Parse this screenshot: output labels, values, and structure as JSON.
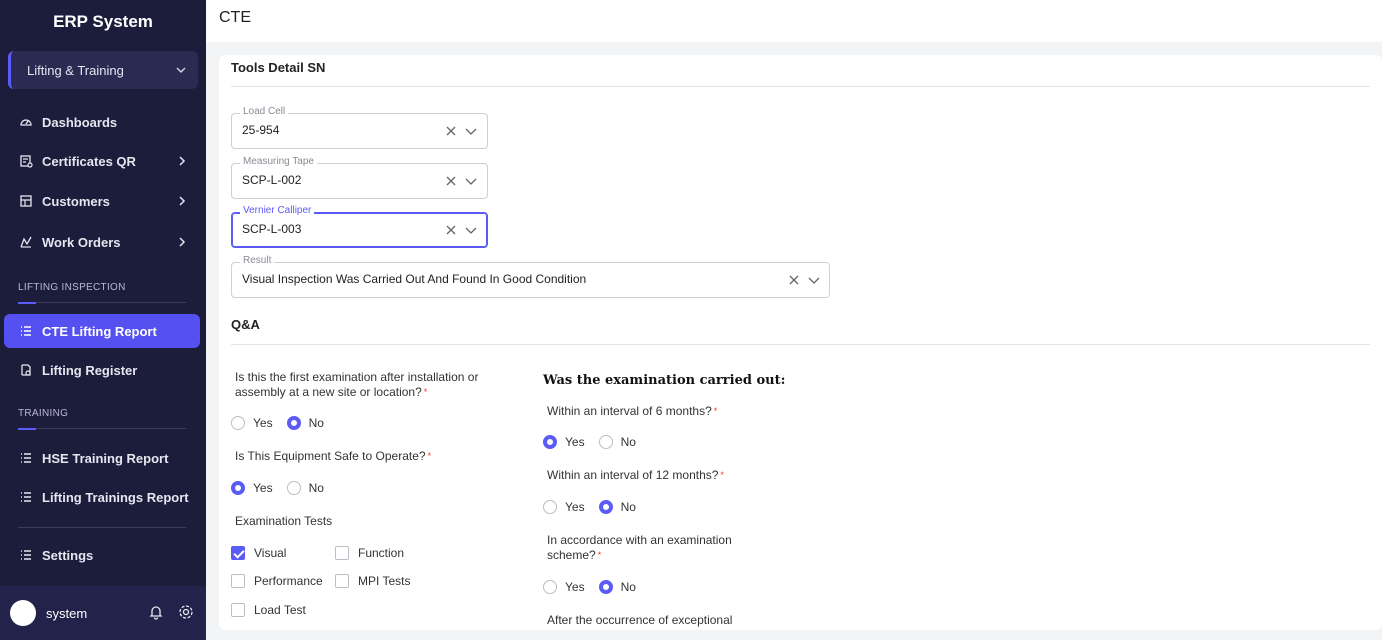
{
  "app": {
    "title": "ERP System"
  },
  "module_select": {
    "value": "Lifting & Training"
  },
  "nav": {
    "dashboards": "Dashboards",
    "certificates": "Certificates QR",
    "customers": "Customers",
    "work_orders": "Work Orders",
    "section_lifting": "LIFTING INSPECTION",
    "cte_lifting": "CTE Lifting Report",
    "lifting_register": "Lifting Register",
    "section_training": "TRAINING",
    "hse_training": "HSE Training Report",
    "lifting_trainings": "Lifting Trainings Report",
    "settings": "Settings"
  },
  "user": {
    "name": "system"
  },
  "page": {
    "title": "CTE"
  },
  "tools": {
    "title": "Tools Detail SN",
    "load_cell": {
      "label": "Load Cell",
      "value": "25-954"
    },
    "measuring_tape": {
      "label": "Measuring Tape",
      "value": "SCP-L-002"
    },
    "vernier": {
      "label": "Vernier Calliper",
      "value": "SCP-L-003"
    },
    "result": {
      "label": "Result",
      "value": "Visual Inspection Was Carried Out And Found In Good Condition"
    }
  },
  "qa": {
    "title": "Q&A",
    "yes": "Yes",
    "no": "No",
    "required_mark": "*",
    "q1": {
      "text": "Is this the first examination after installation or assembly at a new site or location?",
      "answer": "No"
    },
    "q2": {
      "text": "Is This Equipment Safe to Operate?",
      "answer": "Yes"
    },
    "tests": {
      "label": "Examination Tests",
      "items": [
        {
          "label": "Visual",
          "checked": true
        },
        {
          "label": "Function",
          "checked": false
        },
        {
          "label": "Performance",
          "checked": false
        },
        {
          "label": "MPI Tests",
          "checked": false
        },
        {
          "label": "Load Test",
          "checked": false
        }
      ]
    },
    "carried_out": {
      "heading": "Was the examination carried out:",
      "q6": {
        "text": "Within an interval of 6 months?",
        "answer": "Yes"
      },
      "q12": {
        "text": "Within an interval of 12 months?",
        "answer": "No"
      },
      "scheme": {
        "text": "In accordance with an examination scheme?",
        "answer": "No"
      },
      "exceptional": {
        "text": "After the occurrence of exceptional"
      }
    }
  },
  "colors": {
    "sidebar": "#1c1c3b",
    "accent": "#5550f0"
  }
}
